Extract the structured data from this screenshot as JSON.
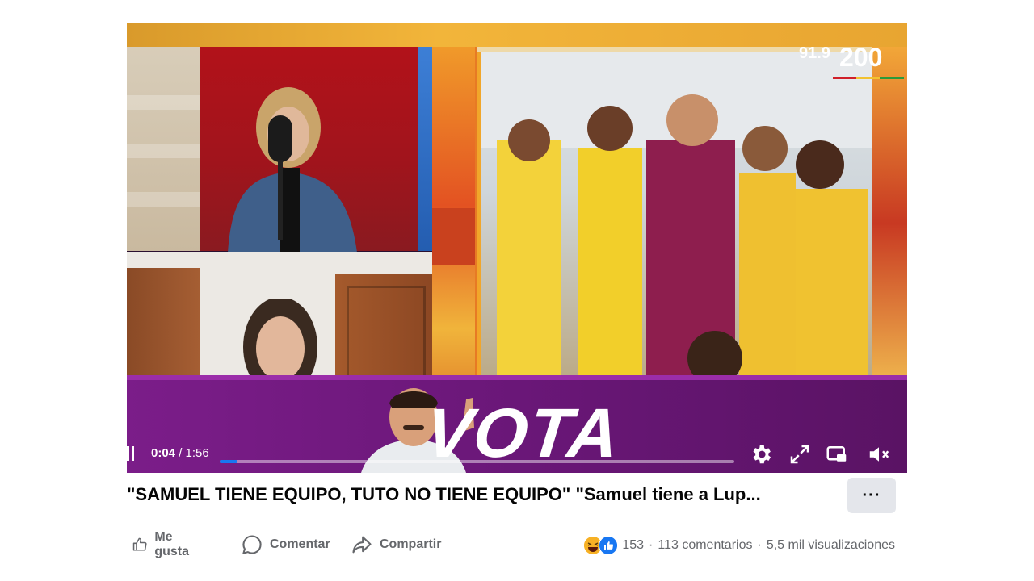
{
  "video": {
    "time_current": "0:04",
    "time_separator": " / ",
    "time_total": "1:56",
    "progress_fraction": 0.0345,
    "overlay_text": "VOTA",
    "logo_freq": "91.9",
    "logo_number": "200"
  },
  "post": {
    "title": "\"SAMUEL TIENE EQUIPO, TUTO NO TIENE EQUIPO\" \"Samuel tiene a Lup...",
    "more_label": "···"
  },
  "actions": {
    "like_label": "Me gusta",
    "comment_label": "Comentar",
    "share_label": "Compartir"
  },
  "stats": {
    "reactions_count": "153",
    "comments": "113 comentarios",
    "views": "5,5 mil visualizaciones",
    "separator": "·"
  },
  "colors": {
    "accent": "#1877f2",
    "band_purple": "#6a1778",
    "text_secondary": "#65676b"
  }
}
